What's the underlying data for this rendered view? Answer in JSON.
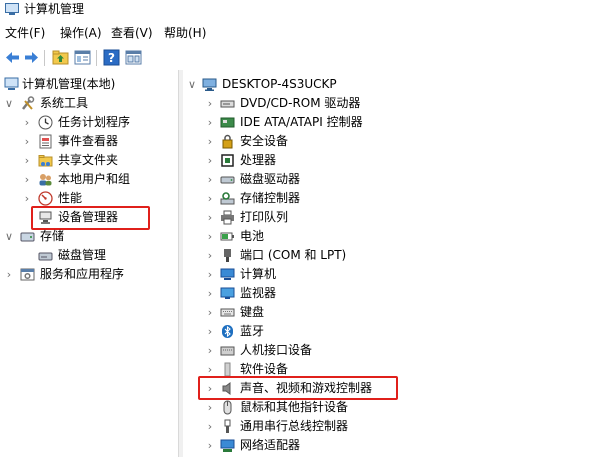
{
  "window": {
    "title": "计算机管理"
  },
  "menu": [
    "文件(F)",
    "操作(A)",
    "查看(V)",
    "帮助(H)"
  ],
  "toolbar": [
    "back-icon",
    "forward-icon",
    "up-folder-icon",
    "show-hide-tree-icon",
    "help-icon",
    "properties-icon"
  ],
  "left_tree": [
    {
      "label": "计算机管理(本地)",
      "icon": "computer-management-icon",
      "expander": "none"
    },
    {
      "label": "系统工具",
      "icon": "tools-icon",
      "expander": "expanded"
    },
    {
      "label": "任务计划程序",
      "icon": "clock-icon",
      "expander": "collapsed"
    },
    {
      "label": "事件查看器",
      "icon": "event-viewer-icon",
      "expander": "collapsed"
    },
    {
      "label": "共享文件夹",
      "icon": "shared-folder-icon",
      "expander": "collapsed"
    },
    {
      "label": "本地用户和组",
      "icon": "users-icon",
      "expander": "collapsed"
    },
    {
      "label": "性能",
      "icon": "performance-icon",
      "expander": "collapsed"
    },
    {
      "label": "设备管理器",
      "icon": "device-manager-icon",
      "expander": "none",
      "highlighted": true
    },
    {
      "label": "存储",
      "icon": "storage-icon",
      "expander": "expanded"
    },
    {
      "label": "磁盘管理",
      "icon": "disk-management-icon",
      "expander": "none"
    },
    {
      "label": "服务和应用程序",
      "icon": "services-icon",
      "expander": "collapsed"
    }
  ],
  "device_tree": {
    "root": {
      "label": "DESKTOP-4S3UCKP",
      "icon": "computer-icon"
    },
    "items": [
      {
        "label": "DVD/CD-ROM 驱动器",
        "icon": "dvd-drive-icon"
      },
      {
        "label": "IDE ATA/ATAPI 控制器",
        "icon": "ide-controller-icon"
      },
      {
        "label": "安全设备",
        "icon": "security-device-icon"
      },
      {
        "label": "处理器",
        "icon": "processor-icon"
      },
      {
        "label": "磁盘驱动器",
        "icon": "disk-drive-icon"
      },
      {
        "label": "存储控制器",
        "icon": "storage-controller-icon"
      },
      {
        "label": "打印队列",
        "icon": "printer-icon"
      },
      {
        "label": "电池",
        "icon": "battery-icon"
      },
      {
        "label": "端口 (COM 和 LPT)",
        "icon": "port-icon"
      },
      {
        "label": "计算机",
        "icon": "computer-icon"
      },
      {
        "label": "监视器",
        "icon": "monitor-icon"
      },
      {
        "label": "键盘",
        "icon": "keyboard-icon"
      },
      {
        "label": "蓝牙",
        "icon": "bluetooth-icon"
      },
      {
        "label": "人机接口设备",
        "icon": "hid-icon"
      },
      {
        "label": "软件设备",
        "icon": "software-device-icon"
      },
      {
        "label": "声音、视频和游戏控制器",
        "icon": "speaker-icon",
        "highlighted": true
      },
      {
        "label": "鼠标和其他指针设备",
        "icon": "mouse-icon"
      },
      {
        "label": "通用串行总线控制器",
        "icon": "usb-icon"
      },
      {
        "label": "网络适配器",
        "icon": "network-adapter-icon"
      }
    ]
  },
  "colors": {
    "highlight_border": "#e0201b",
    "accent": "#1e6fc0"
  }
}
